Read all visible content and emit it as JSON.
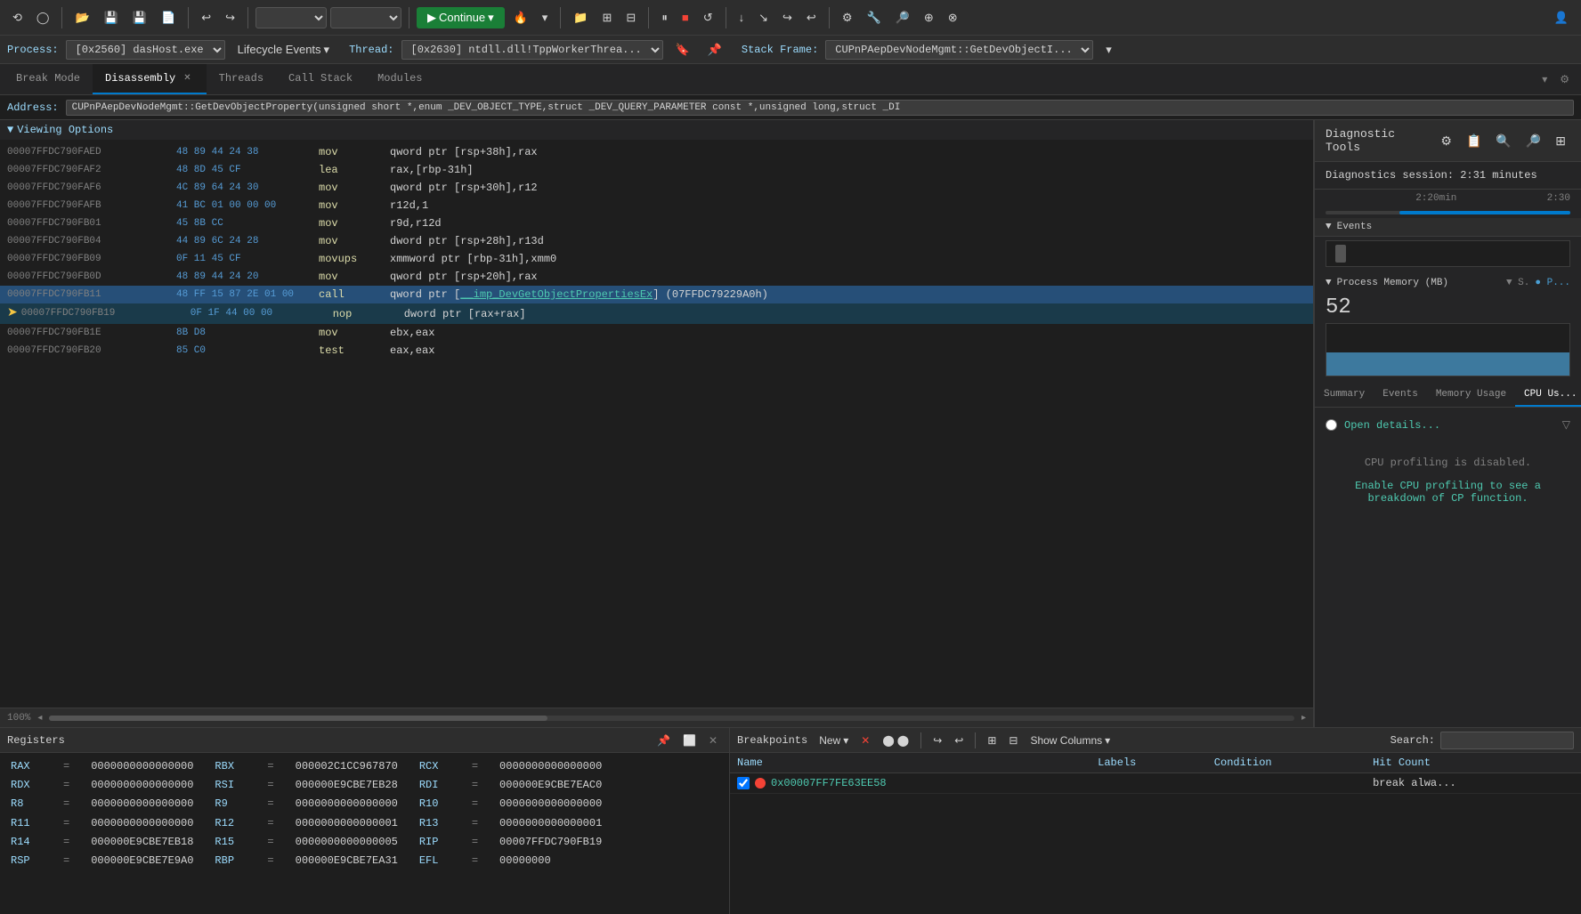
{
  "toolbar": {
    "continue_label": "Continue",
    "dropdown1": "",
    "dropdown2": ""
  },
  "process_bar": {
    "process_label": "Process:",
    "process_value": "[0x2560] dasHost.exe",
    "lifecycle_label": "Lifecycle Events",
    "thread_label": "Thread:",
    "thread_value": "[0x2630] ntdll.dll!TppWorkerThrea...",
    "stack_frame_label": "Stack Frame:",
    "stack_frame_value": "CUPnPAepDevNodeMgmt::GetDevObjectI..."
  },
  "tabs": [
    {
      "label": "Break Mode",
      "active": false,
      "closeable": false
    },
    {
      "label": "Disassembly",
      "active": true,
      "closeable": true
    },
    {
      "label": "Threads",
      "active": false,
      "closeable": false
    },
    {
      "label": "Call Stack",
      "active": false,
      "closeable": false
    },
    {
      "label": "Modules",
      "active": false,
      "closeable": false
    }
  ],
  "address_bar": {
    "label": "Address:",
    "value": "CUPnPAepDevNodeMgmt::GetDevObjectProperty(unsigned short *,enum _DEV_OBJECT_TYPE,struct _DEV_QUERY_PARAMETER const *,unsigned long,struct _DI"
  },
  "viewing_options": {
    "label": "Viewing Options"
  },
  "disasm_rows": [
    {
      "addr": "00007FFDC790FAED",
      "bytes": "48 89 44 24 38",
      "mnemonic": "mov",
      "operands": "qword ptr [rsp+38h],rax",
      "highlighted": false,
      "current": false
    },
    {
      "addr": "00007FFDC790FAF2",
      "bytes": "48 8D 45 CF",
      "mnemonic": "lea",
      "operands": "rax,[rbp-31h]",
      "highlighted": false,
      "current": false
    },
    {
      "addr": "00007FFDC790FAF6",
      "bytes": "4C 89 64 24 30",
      "mnemonic": "mov",
      "operands": "qword ptr [rsp+30h],r12",
      "highlighted": false,
      "current": false
    },
    {
      "addr": "00007FFDC790FAFB",
      "bytes": "41 BC 01 00 00 00",
      "mnemonic": "mov",
      "operands": "r12d,1",
      "highlighted": false,
      "current": false
    },
    {
      "addr": "00007FFDC790FB01",
      "bytes": "45 8B CC",
      "mnemonic": "mov",
      "operands": "r9d,r12d",
      "highlighted": false,
      "current": false
    },
    {
      "addr": "00007FFDC790FB04",
      "bytes": "44 89 6C 24 28",
      "mnemonic": "mov",
      "operands": "dword ptr [rsp+28h],r13d",
      "highlighted": false,
      "current": false
    },
    {
      "addr": "00007FFDC790FB09",
      "bytes": "0F 11 45 CF",
      "mnemonic": "movups",
      "operands": "xmmword ptr [rbp-31h],xmm0",
      "highlighted": false,
      "current": false
    },
    {
      "addr": "00007FFDC790FB0D",
      "bytes": "48 89 44 24 20",
      "mnemonic": "mov",
      "operands": "qword ptr [rsp+20h],rax",
      "highlighted": false,
      "current": false
    },
    {
      "addr": "00007FFDC790FB11",
      "bytes": "48 FF 15 87 2E 01 00",
      "mnemonic": "call",
      "operands": "qword ptr [__imp_DevGetObjectPropertiesEx] (07FFDC79229A0h)",
      "highlighted": true,
      "current": false
    },
    {
      "addr": "00007FFDC790FB19",
      "bytes": "0F 1F 44 00 00",
      "mnemonic": "nop",
      "operands": "dword ptr [rax+rax]",
      "highlighted": false,
      "current": true
    },
    {
      "addr": "00007FFDC790FB1E",
      "bytes": "8B D8",
      "mnemonic": "mov",
      "operands": "ebx,eax",
      "highlighted": false,
      "current": false
    },
    {
      "addr": "00007FFDC790FB20",
      "bytes": "85 C0",
      "mnemonic": "test",
      "operands": "eax,eax",
      "highlighted": false,
      "current": false
    }
  ],
  "zoom": "100%",
  "diagnostic": {
    "title": "Diagnostic Tools",
    "session_label": "Diagnostics session: 2:31 minutes",
    "time_labels": [
      "2:20min",
      "2:30"
    ],
    "events_section": "Events",
    "memory_section": "Process Memory (MB)",
    "memory_value": "52",
    "memory_legend": [
      "S.",
      "P..."
    ],
    "tabs": [
      {
        "label": "Summary",
        "active": false
      },
      {
        "label": "Events",
        "active": false
      },
      {
        "label": "Memory Usage",
        "active": false
      },
      {
        "label": "CPU Us...",
        "active": true
      }
    ],
    "cpu": {
      "open_details": "Open details...",
      "profiling_disabled": "CPU profiling is disabled.",
      "enable_link": "Enable CPU profiling to see a breakdown of CP function."
    }
  },
  "registers": {
    "title": "Registers",
    "rows": [
      {
        "regs": [
          {
            "name": "RAX",
            "val": "0000000000000000"
          },
          {
            "name": "RBX",
            "val": "000002C1CC967870"
          },
          {
            "name": "RCX",
            "val": "0000000000000000"
          }
        ]
      },
      {
        "regs": [
          {
            "name": "RDX",
            "val": "0000000000000000"
          },
          {
            "name": "RSI",
            "val": "000000E9CBE7EB28"
          },
          {
            "name": "RDI",
            "val": "000000E9CBE7EAC0"
          }
        ]
      },
      {
        "regs": [
          {
            "name": "R8",
            "val": "0000000000000000"
          },
          {
            "name": "R9",
            "val": "0000000000000000"
          },
          {
            "name": "R10",
            "val": "0000000000000000"
          }
        ]
      },
      {
        "regs": [
          {
            "name": "R11",
            "val": "0000000000000000"
          },
          {
            "name": "R12",
            "val": "0000000000000001"
          },
          {
            "name": "R13",
            "val": "0000000000000001"
          }
        ]
      },
      {
        "regs": [
          {
            "name": "R14",
            "val": "000000E9CBE7EB18"
          },
          {
            "name": "R15",
            "val": "0000000000000005"
          },
          {
            "name": "RIP",
            "val": "00007FFDC790FB19"
          }
        ]
      },
      {
        "regs": [
          {
            "name": "RSP",
            "val": "000000E9CBE7E9A0"
          },
          {
            "name": "RBP",
            "val": "000000E9CBE7EA31"
          },
          {
            "name": "EFL",
            "val": "00000000"
          }
        ]
      }
    ]
  },
  "breakpoints": {
    "title": "Breakpoints",
    "toolbar": {
      "new_label": "New",
      "show_columns_label": "Show Columns",
      "search_label": "Search:",
      "search_placeholder": ""
    },
    "columns": [
      "Name",
      "Labels",
      "Condition",
      "Hit Count"
    ],
    "rows": [
      {
        "enabled": true,
        "address": "0x00007FF7FE63EE58",
        "condition": "break alwa..."
      }
    ]
  }
}
